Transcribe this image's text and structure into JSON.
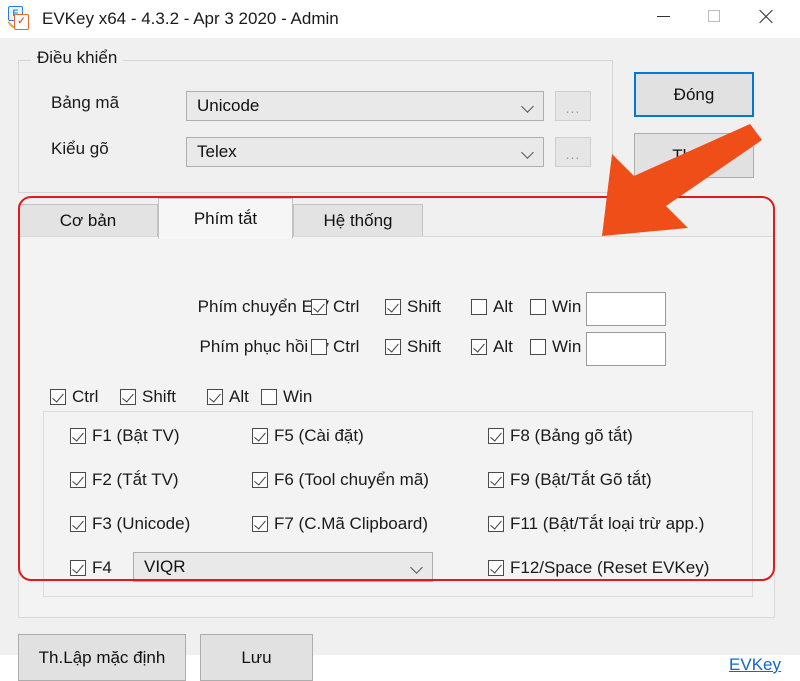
{
  "window": {
    "title": "EVKey x64 - 4.3.2 - Apr  3 2020 - Admin",
    "icon": "evkey-app-icon",
    "minimize": "—",
    "maximize": "□",
    "close": "✕"
  },
  "control_group": {
    "legend": "Điều khiển",
    "rows": [
      {
        "label": "Bảng mã",
        "value": "Unicode",
        "ellipsis": "..."
      },
      {
        "label": "Kiểu gõ",
        "value": "Telex",
        "ellipsis": "..."
      }
    ]
  },
  "side_buttons": {
    "close_label": "Đóng",
    "exit_label": "Thoát"
  },
  "tabs": [
    {
      "label": "Cơ bản",
      "active": false
    },
    {
      "label": "Phím tắt",
      "active": true
    },
    {
      "label": "Hệ thống",
      "active": false
    }
  ],
  "hotkey_rows": [
    {
      "label": "Phím chuyển E/V",
      "modifiers": [
        {
          "label": "Ctrl",
          "checked": true
        },
        {
          "label": "Shift",
          "checked": true
        },
        {
          "label": "Alt",
          "checked": false
        },
        {
          "label": "Win",
          "checked": false
        }
      ],
      "textbox_value": ""
    },
    {
      "label": "Phím phục hồi từ",
      "modifiers": [
        {
          "label": "Ctrl",
          "checked": false
        },
        {
          "label": "Shift",
          "checked": true
        },
        {
          "label": "Alt",
          "checked": true
        },
        {
          "label": "Win",
          "checked": false
        }
      ],
      "textbox_value": ""
    }
  ],
  "global_modifiers": [
    {
      "label": "Ctrl",
      "checked": true
    },
    {
      "label": "Shift",
      "checked": true
    },
    {
      "label": "Alt",
      "checked": true
    },
    {
      "label": "Win",
      "checked": false
    }
  ],
  "function_keys": {
    "column1": [
      {
        "label": "F1 (Bật TV)",
        "checked": true
      },
      {
        "label": "F2 (Tắt TV)",
        "checked": true
      },
      {
        "label": "F3 (Unicode)",
        "checked": true
      },
      {
        "label": "F4",
        "checked": true
      }
    ],
    "column2": [
      {
        "label": "F5 (Cài đặt)",
        "checked": true
      },
      {
        "label": "F6 (Tool chuyển mã)",
        "checked": true
      },
      {
        "label": "F7 (C.Mã Clipboard)",
        "checked": true
      }
    ],
    "column3": [
      {
        "label": "F8 (Bảng gõ tắt)",
        "checked": true
      },
      {
        "label": "F9 (Bật/Tắt Gõ tắt)",
        "checked": true
      },
      {
        "label": "F11 (Bật/Tắt loại trừ app.)",
        "checked": true
      },
      {
        "label": "F12/Space (Reset EVKey)",
        "checked": true
      }
    ],
    "f4_combo_value": "VIQR"
  },
  "footer": {
    "default_label": "Th.Lập mặc định",
    "save_label": "Lưu",
    "link_label": "EVKey"
  },
  "annotations": {
    "arrow_color": "#f04e18",
    "highlight_color": "#e01b1b"
  }
}
